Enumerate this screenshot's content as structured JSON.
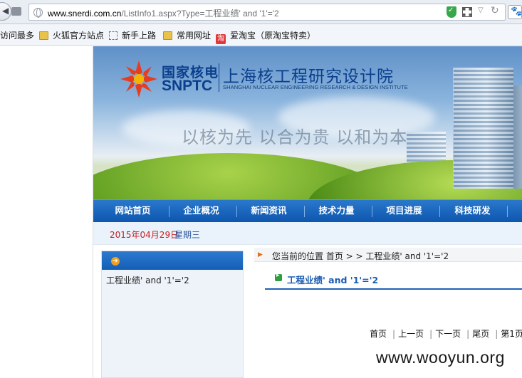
{
  "browser": {
    "url_host": "www.snerdi.com.cn",
    "url_path": "/ListInfo1.aspx?Type=工程业绩' and '1'='2",
    "bookmarks": [
      {
        "label": "访问最多",
        "icon": "none"
      },
      {
        "label": "火狐官方站点",
        "icon": "folder-icon"
      },
      {
        "label": "新手上路",
        "icon": "dashed-page-icon"
      },
      {
        "label": "常用网址",
        "icon": "folder-icon"
      },
      {
        "label": "爱淘宝（原淘宝特卖）",
        "icon": "taobao-icon"
      }
    ],
    "taobao_icon_glyph": "淘",
    "back_glyph": "◀",
    "paw_glyph": "🐾"
  },
  "banner": {
    "logo_cn": "国家核电",
    "logo_en": "SNPTC",
    "institute_cn": "上海核工程研究设计院",
    "institute_en": "SHANGHAI NUCLEAR ENGINEERING RESEARCH & DESIGN INSTITUTE",
    "slogan": "以核为先 以合为贵 以和为本",
    "logo_color": "#e83c1e",
    "brand_color": "#0b3f8c"
  },
  "nav": {
    "items": [
      "网站首页",
      "企业概况",
      "新闻资讯",
      "技术力量",
      "项目进展",
      "科技研发"
    ]
  },
  "datebar": {
    "date": "2015年04月29日",
    "weekday": "星期三"
  },
  "sidebar": {
    "link": "工程业绩' and '1'='2"
  },
  "breadcrumb": {
    "text": "您当前的位置 首页 > > 工程业绩' and '1'='2"
  },
  "content": {
    "title": "工程业绩' and '1'='2"
  },
  "pager": {
    "first": "首页",
    "prev": "上一页",
    "next": "下一页",
    "last": "尾页",
    "page_info": "第1页"
  },
  "watermark": "www.wooyun.org"
}
